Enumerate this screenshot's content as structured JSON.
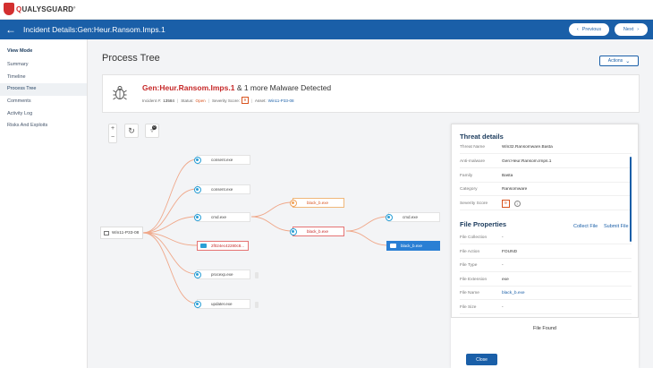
{
  "brand": {
    "q": "Q",
    "rest": "UALYSGUARD",
    "reg": "®"
  },
  "nav": {
    "title": "Incident Details:Gen:Heur.Ransom.Imps.1",
    "previous": "Previous",
    "next": "Next"
  },
  "sidebar": {
    "heading": "View Mode",
    "items": [
      {
        "label": "Summary"
      },
      {
        "label": "Timeline"
      },
      {
        "label": "Process Tree",
        "active": true
      },
      {
        "label": "Comments"
      },
      {
        "label": "Activity Log"
      },
      {
        "label": "Risks And Exploits"
      }
    ]
  },
  "page": {
    "title": "Process Tree",
    "actions": "Actions"
  },
  "incident": {
    "title_highlight": "Gen:Heur.Ransom.Imps.1",
    "title_rest": " & 1 more Malware Detected",
    "incident_label": "Incident #:",
    "incident_no": "13584",
    "status_label": "Status:",
    "status": "Open",
    "severity_label": "Severity Score:",
    "severity": "9",
    "asset_label": "Asset:",
    "asset": "Win11-P33-08"
  },
  "tree": {
    "root": "Win11-P33-08",
    "nodes": [
      {
        "label": "consent.exe"
      },
      {
        "label": "consent.exe"
      },
      {
        "label": "cmd.exe"
      },
      {
        "label": "2f024ec42280c8..."
      },
      {
        "label": "procexp.exe"
      },
      {
        "label": "updater.exe"
      },
      {
        "label": "black_b.exe"
      },
      {
        "label": "black_b.exe"
      },
      {
        "label": "cmd.exe"
      },
      {
        "label": "black_b.exe"
      }
    ],
    "badge_count": "0"
  },
  "threat": {
    "heading": "Threat details",
    "rows": [
      {
        "k": "Threat Name",
        "v": "Win32.Ransomware.Basta"
      },
      {
        "k": "Anti-malware",
        "v": "Gen:Heur.Ransom.Imps.1"
      },
      {
        "k": "Family",
        "v": "Basta"
      },
      {
        "k": "Category",
        "v": "Ransomware"
      },
      {
        "k": "Severity Score",
        "v": "9"
      }
    ]
  },
  "file_props": {
    "heading": "File Properties",
    "collect": "Collect File",
    "submit": "Submit File",
    "rows": [
      {
        "k": "File Collection",
        "v": "-"
      },
      {
        "k": "File Action",
        "v": "FOUND"
      },
      {
        "k": "File Type",
        "v": "-"
      },
      {
        "k": "File Extension",
        "v": "exe"
      },
      {
        "k": "File Name",
        "v": "black_b.exe"
      },
      {
        "k": "File Size",
        "v": "-"
      }
    ]
  },
  "footer": {
    "file_found": "File Found",
    "close": "Close"
  },
  "colors": {
    "brand_blue": "#1a5fa8",
    "alert_red": "#c62828",
    "severity_orange": "#d9531e",
    "node_blue": "#2a9fd6"
  }
}
